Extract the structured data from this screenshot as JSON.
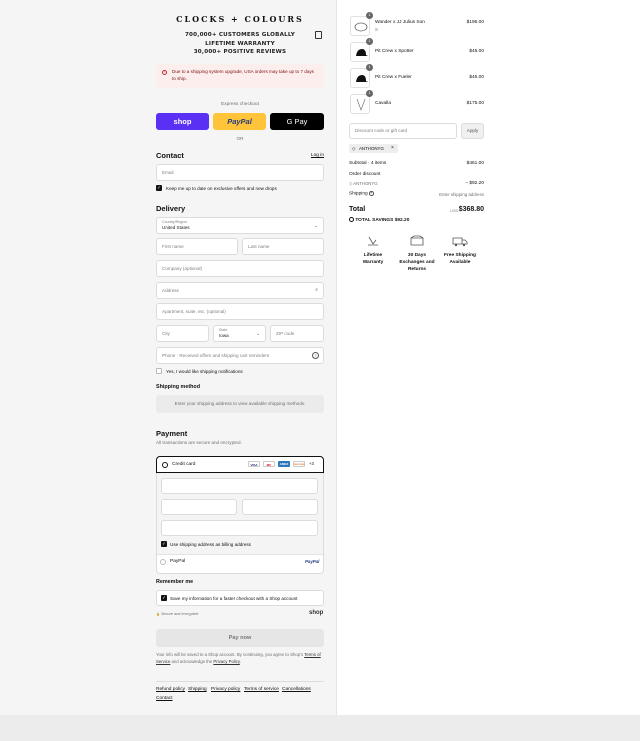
{
  "brand": "CLOCKS + COLOURS",
  "stats": [
    "700,000+ CUSTOMERS GLOBALLY",
    "LIFETIME WARRANTY",
    "30,000+ POSITIVE REVIEWS"
  ],
  "alert": "Due to a shipping system upgrade, USA orders may take up to 7 days to ship.",
  "express": {
    "label": "Express checkout",
    "shop": "shop",
    "paypal": "PayPal",
    "gpay": "G Pay",
    "or": "OR"
  },
  "contact": {
    "title": "Contact",
    "login": "Log in",
    "email_placeholder": "Email",
    "newsletter": "Keep me up to date on exclusive offers and new drops"
  },
  "delivery": {
    "title": "Delivery",
    "country_label": "Country/Region",
    "country_value": "United States",
    "first_name": "First name",
    "last_name": "Last name",
    "company": "Company (optional)",
    "address": "Address",
    "apartment": "Apartment, suite, etc. (optional)",
    "city": "City",
    "state_label": "State",
    "state_value": "Iowa",
    "zip": "ZIP code",
    "phone": "Phone · Received offers and shipping cart reminders",
    "shipping_notify": "Yes, I would like shipping notifications"
  },
  "shipping_method": {
    "title": "Shipping method",
    "note": "Enter your shipping address to view available shipping methods."
  },
  "payment": {
    "title": "Payment",
    "subtitle": "All transactions are secure and encrypted.",
    "credit_card": "Credit card",
    "cards": [
      "VISA",
      "MC",
      "AMEX",
      "DISCOVER"
    ],
    "more": "+3",
    "billing_same": "Use shipping address as billing address",
    "paypal": "PayPal",
    "paypal_logo": "PayPal"
  },
  "remember": {
    "title": "Remember me",
    "save": "Save my information for a faster checkout with a Shop account",
    "secure": "Secure and encrypted",
    "shop": "shop"
  },
  "pay_now": "Pay now",
  "legal": {
    "line1": "Your info will be saved to a Shop account. By continuing, you agree to Shop's",
    "tos": "Terms of Service",
    "mid": "and acknowledge the",
    "privacy": "Privacy Policy",
    "end": "."
  },
  "footer_links": [
    "Refund policy",
    "Shipping",
    "Privacy policy",
    "Terms of service",
    "Cancellations",
    "Contact"
  ],
  "cart": {
    "items": [
      {
        "name": "Wander x JJ Julius Son",
        "variant": "S",
        "qty": "1",
        "price": "$196.00",
        "icon": "necklace-icon"
      },
      {
        "name": "Pit Crew x Spotter",
        "variant": "",
        "qty": "1",
        "price": "$45.00",
        "icon": "cap-icon"
      },
      {
        "name": "Pit Crew x Fueler",
        "variant": "",
        "qty": "1",
        "price": "$45.00",
        "icon": "cap-icon"
      },
      {
        "name": "Cavalla",
        "variant": "",
        "qty": "1",
        "price": "$175.00",
        "icon": "chain-icon"
      }
    ],
    "discount_placeholder": "Discount code or gift card",
    "apply": "Apply",
    "code": "ANTHONYG",
    "subtotal_label": "Subtotal · 4 items",
    "subtotal": "$461.00",
    "order_discount_label": "Order discount",
    "discount_code": "ANTHONYG",
    "discount_value": "– $92.20",
    "shipping_label": "Shipping",
    "shipping_value": "Enter shipping address",
    "total_label": "Total",
    "currency": "USD",
    "total": "$368.80",
    "savings_label": "TOTAL SAVINGS",
    "savings": "$92.20"
  },
  "perks": [
    {
      "line1": "Lifetime",
      "line2": "Warranty",
      "line3": "",
      "icon": "warranty-icon"
    },
    {
      "line1": "30 Days",
      "line2": "Exchanges and",
      "line3": "Returns",
      "icon": "box-icon"
    },
    {
      "line1": "Free Shipping",
      "line2": "Available",
      "line3": "",
      "icon": "truck-icon"
    }
  ]
}
